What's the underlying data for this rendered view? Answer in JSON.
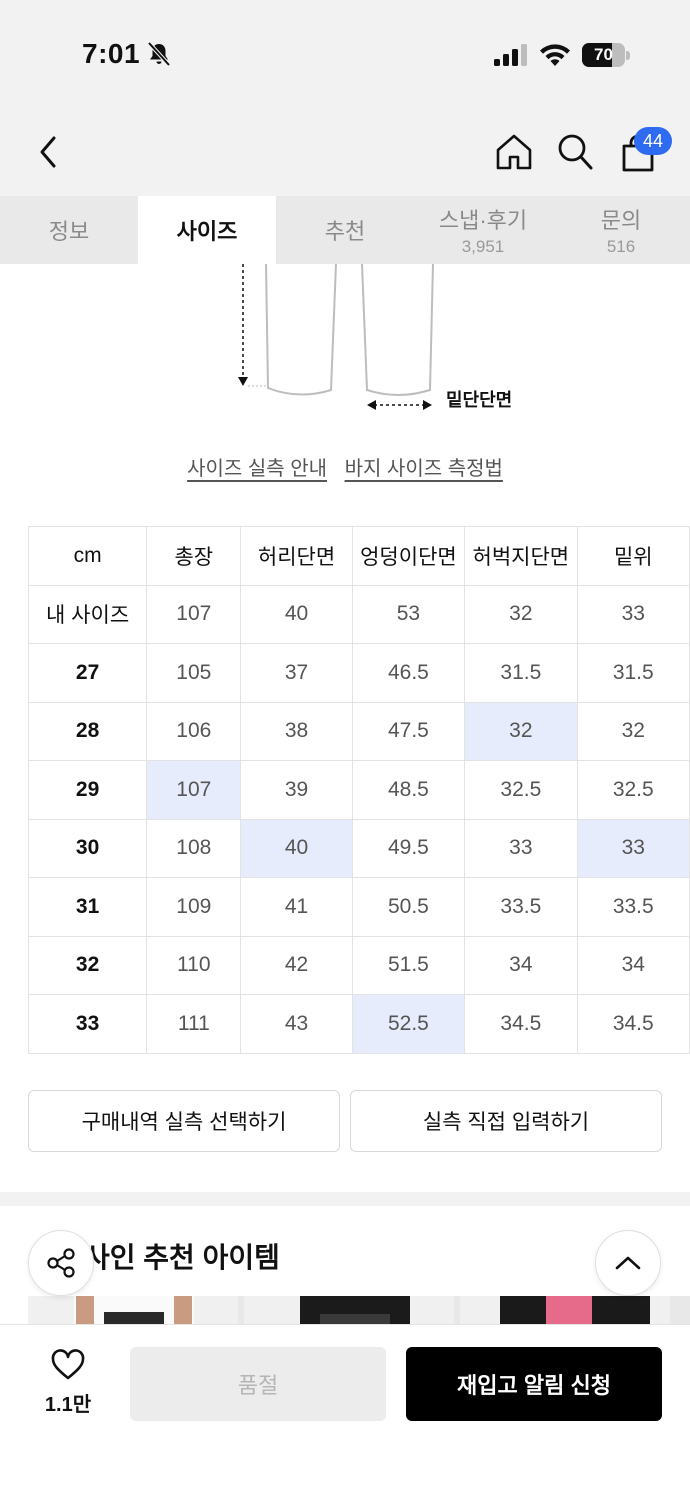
{
  "status_bar": {
    "time": "7:01",
    "battery": "70",
    "battery_level": 0.7
  },
  "header": {
    "cart_count": "44"
  },
  "tabs": [
    {
      "label": "정보",
      "sub": ""
    },
    {
      "label": "사이즈",
      "sub": "",
      "active": true
    },
    {
      "label": "추천",
      "sub": ""
    },
    {
      "label": "스냅·후기",
      "sub": "3,951"
    },
    {
      "label": "문의",
      "sub": "516"
    }
  ],
  "diagram": {
    "hem_label": "밑단단면"
  },
  "links": {
    "size_guide": "사이즈 실측 안내",
    "pants_measure": "바지 사이즈 측정법"
  },
  "size_table": {
    "headers": [
      "cm",
      "총장",
      "허리단면",
      "엉덩이단면",
      "허벅지단면",
      "밑위"
    ],
    "rows": [
      {
        "label": "내 사이즈",
        "values": [
          "107",
          "40",
          "53",
          "32",
          "33"
        ]
      },
      {
        "label": "27",
        "values": [
          "105",
          "37",
          "46.5",
          "31.5",
          "31.5"
        ]
      },
      {
        "label": "28",
        "values": [
          "106",
          "38",
          "47.5",
          "32",
          "32"
        ]
      },
      {
        "label": "29",
        "values": [
          "107",
          "39",
          "48.5",
          "32.5",
          "32.5"
        ]
      },
      {
        "label": "30",
        "values": [
          "108",
          "40",
          "49.5",
          "33",
          "33"
        ]
      },
      {
        "label": "31",
        "values": [
          "109",
          "41",
          "50.5",
          "33.5",
          "33.5"
        ]
      },
      {
        "label": "32",
        "values": [
          "110",
          "42",
          "51.5",
          "34",
          "34"
        ]
      },
      {
        "label": "33",
        "values": [
          "111",
          "43",
          "52.5",
          "34.5",
          "34.5"
        ]
      }
    ]
  },
  "actions": {
    "purchase_history": "구매내역 실측 선택하기",
    "manual_input": "실측 직접 입력하기"
  },
  "recommend": {
    "title": "사인 추천 아이템"
  },
  "bottom_bar": {
    "like_count": "1.1만",
    "soldout": "품절",
    "restock": "재입고 알림 신청"
  },
  "colors": {
    "accent": "#2f6bf0",
    "highlight": "#e6ecfb"
  }
}
